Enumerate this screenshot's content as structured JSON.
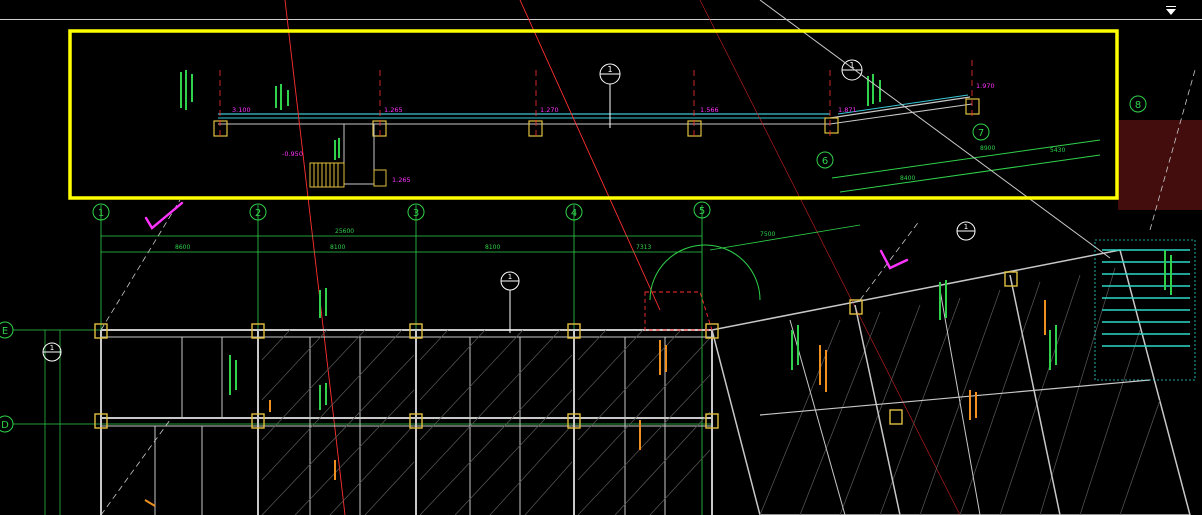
{
  "canvas": {
    "background": "#000000",
    "highlight_color": "#ffff00",
    "check_mark_color": "#ff33ff"
  },
  "axes": {
    "col_1": "1",
    "col_2": "2",
    "col_3": "3",
    "col_4": "4",
    "col_5": "5",
    "col_6": "6",
    "col_7": "7",
    "col_8": "8",
    "row_e": "E",
    "row_d": "D"
  },
  "dims": {
    "top_total": "25600",
    "d_8600": "8600",
    "d_8100": "8100",
    "d_7313": "7313",
    "d_7500": "7500",
    "d_8400": "8400",
    "d_8900": "8900",
    "d_5430": "5430"
  },
  "elevations": {
    "e_3100": "3.100",
    "e_1265": "1.265",
    "e_1270": "1.270",
    "e_1566": "1.566",
    "e_1871": "1.871",
    "e_1970": "1.970",
    "e_0950": "-0.950",
    "e_1265b": "1.265"
  },
  "marks": {
    "sym_main": "1",
    "sym_upper": "1",
    "sym_mid": "1",
    "sym_right": "1",
    "sym_left": "1"
  }
}
